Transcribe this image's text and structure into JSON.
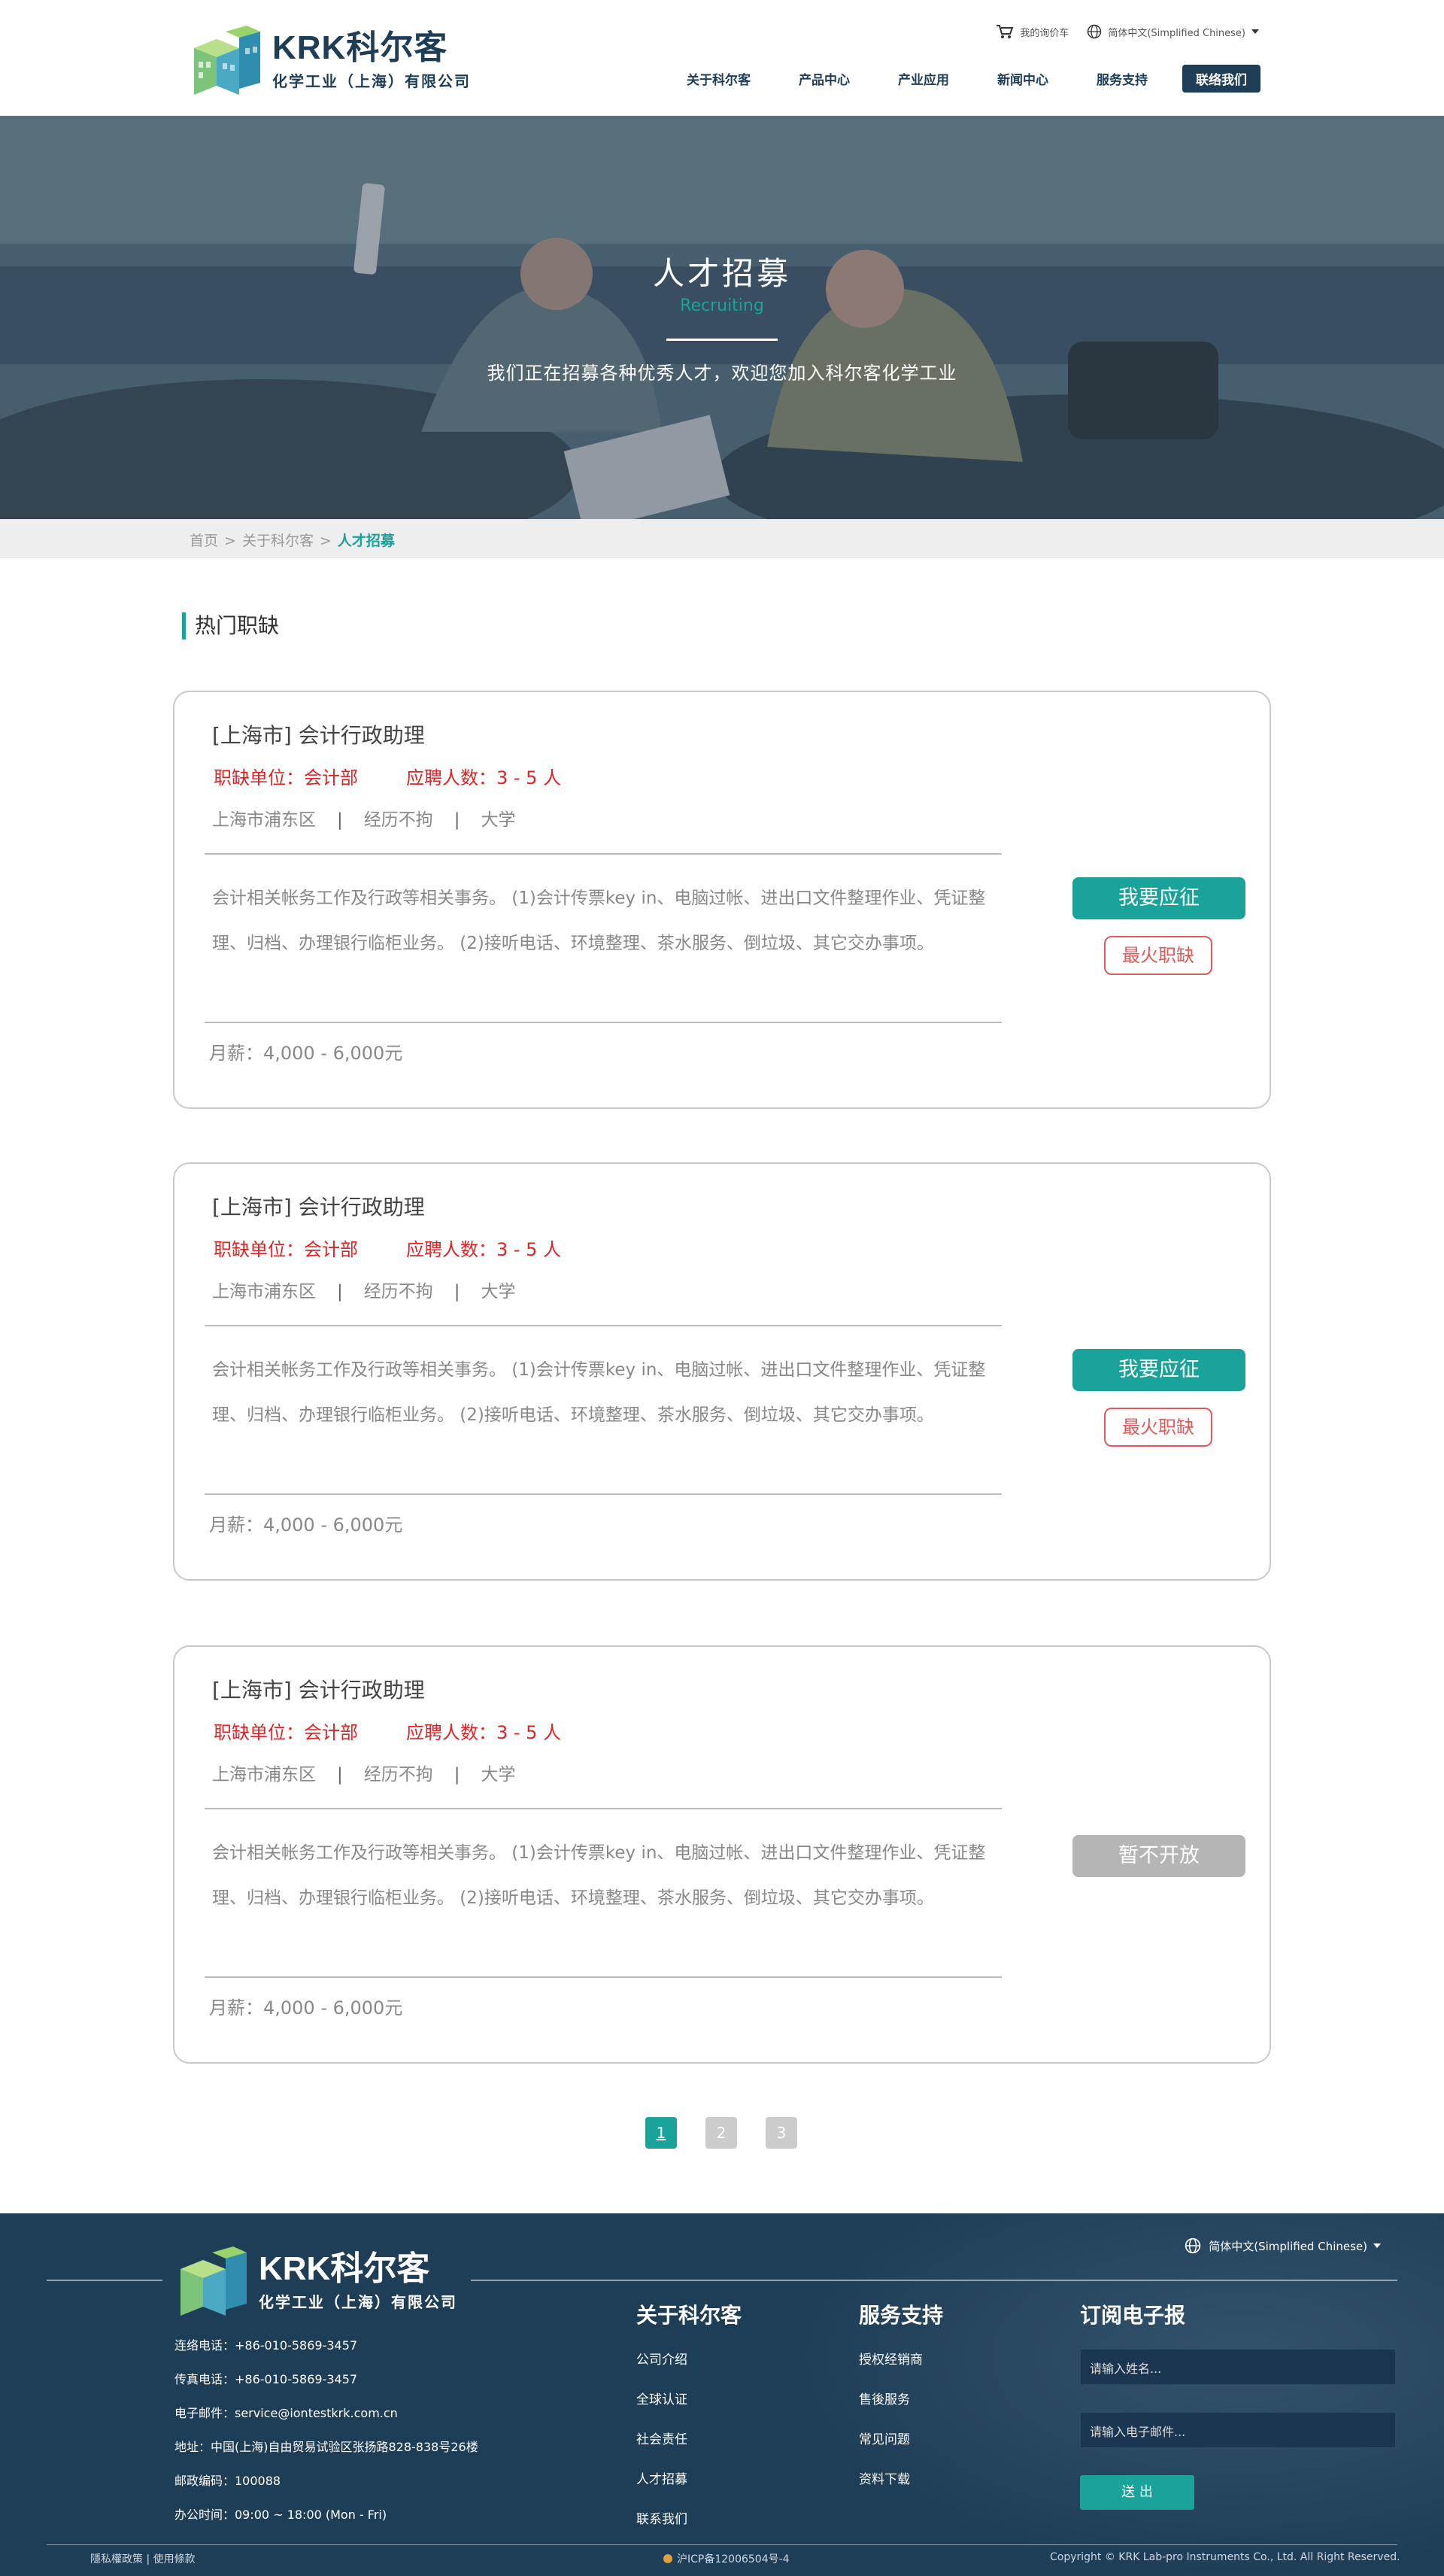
{
  "header": {
    "logo_main": "KRK科尔客",
    "logo_sub": "化学工业（上海）有限公司",
    "cart_label": "我的询价车",
    "lang_label": "简体中文(Simplified Chinese)",
    "nav": [
      "关于科尔客",
      "产品中心",
      "产业应用",
      "新闻中心",
      "服务支持"
    ],
    "nav_cta": "联络我们"
  },
  "hero": {
    "title": "人才招募",
    "subtitle": "Recruiting",
    "description": "我们正在招募各种优秀人才，欢迎您加入科尔客化学工业"
  },
  "breadcrumb": {
    "items": [
      "首页",
      "关于科尔客",
      "人才招募"
    ],
    "separator": ">"
  },
  "section_title": "热门职缺",
  "jobs": [
    {
      "title": "[上海市] 会计行政助理",
      "unit": "职缺单位：会计部",
      "headcount": "应聘人数：3 - 5 人",
      "location": "上海市浦东区",
      "experience": "经历不拘",
      "education": "大学",
      "tag_sep": "|",
      "description": "会计相关帐务工作及行政等相关事务。 (1)会计传票key in、电脑过帐、进出口文件整理作业、凭证整理、归档、办理银行临柜业务。 (2)接听电话、环境整理、茶水服务、倒垃圾、其它交办事项。",
      "salary": "月薪：4,000 - 6,000元",
      "apply_label": "我要应征",
      "hot_label": "最火职缺"
    },
    {
      "title": "[上海市] 会计行政助理",
      "unit": "职缺单位：会计部",
      "headcount": "应聘人数：3 - 5 人",
      "location": "上海市浦东区",
      "experience": "经历不拘",
      "education": "大学",
      "tag_sep": "|",
      "description": "会计相关帐务工作及行政等相关事务。 (1)会计传票key in、电脑过帐、进出口文件整理作业、凭证整理、归档、办理银行临柜业务。 (2)接听电话、环境整理、茶水服务、倒垃圾、其它交办事项。",
      "salary": "月薪：4,000 - 6,000元",
      "apply_label": "我要应征",
      "hot_label": "最火职缺"
    },
    {
      "title": "[上海市] 会计行政助理",
      "unit": "职缺单位：会计部",
      "headcount": "应聘人数：3 - 5 人",
      "location": "上海市浦东区",
      "experience": "经历不拘",
      "education": "大学",
      "tag_sep": "|",
      "description": "会计相关帐务工作及行政等相关事务。 (1)会计传票key in、电脑过帐、进出口文件整理作业、凭证整理、归档、办理银行临柜业务。 (2)接听电话、环境整理、茶水服务、倒垃圾、其它交办事项。",
      "salary": "月薪：4,000 - 6,000元",
      "closed_label": "暂不开放"
    }
  ],
  "pagination": [
    "1",
    "2",
    "3"
  ],
  "footer": {
    "logo_main": "KRK科尔客",
    "logo_sub": "化学工业（上海）有限公司",
    "lang_label": "简体中文(Simplified Chinese)",
    "contacts": [
      "连络电话：+86-010-5869-3457",
      "传真电话：+86-010-5869-3457",
      "电子邮件：service@iontestkrk.com.cn",
      "地址：中国(上海)自由贸易试验区张扬路828-838号26楼",
      "邮政编码：100088",
      "办公时间：09:00 ~ 18:00 (Mon - Fri)"
    ],
    "col_about": {
      "title": "关于科尔客",
      "items": [
        "公司介绍",
        "全球认证",
        "社会责任",
        "人才招募",
        "联系我们"
      ]
    },
    "col_service": {
      "title": "服务支持",
      "items": [
        "授权经销商",
        "售後服务",
        "常见问题",
        "资料下载"
      ]
    },
    "col_newsletter": {
      "title": "订阅电子报",
      "name_placeholder": "请输入姓名...",
      "email_placeholder": "请输入电子邮件...",
      "submit_label": "送 出"
    },
    "privacy": "隱私權政策 | 使用條款",
    "icp": "沪ICP备12006504号-4",
    "copyright": "Copyright © KRK Lab-pro Instruments Co., Ltd. All Right Reserved."
  },
  "colors": {
    "brand_navy": "#1e3d57",
    "accent_teal": "#1aa39a",
    "alert_red": "#e02424",
    "disabled_gray": "#b5b5b5"
  }
}
